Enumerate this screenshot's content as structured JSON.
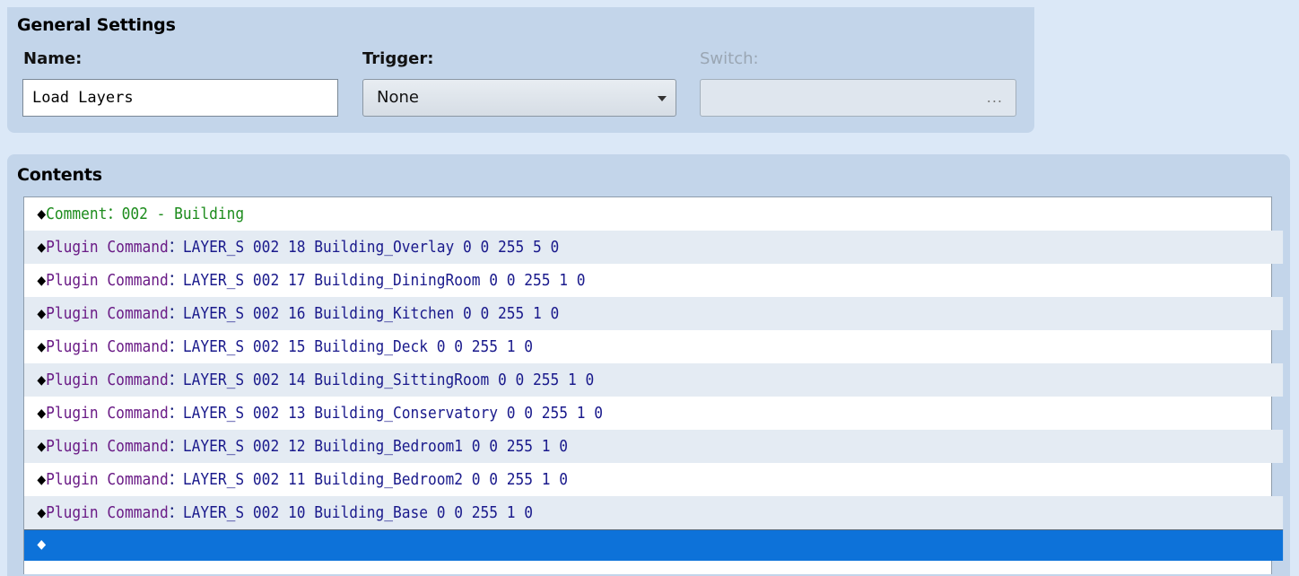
{
  "general": {
    "title": "General Settings",
    "name_label": "Name:",
    "name_value": "Load Layers",
    "trigger_label": "Trigger:",
    "trigger_value": "None",
    "switch_label": "Switch:",
    "switch_button": "..."
  },
  "contents": {
    "title": "Contents",
    "rows": [
      {
        "marker": "◆",
        "command": "Comment",
        "sep": "：",
        "args": "002 - Building"
      },
      {
        "marker": "◆",
        "command": "Plugin Command",
        "sep": "：",
        "args": "LAYER_S 002 18 Building_Overlay 0 0 255 5 0"
      },
      {
        "marker": "◆",
        "command": "Plugin Command",
        "sep": "：",
        "args": "LAYER_S 002 17 Building_DiningRoom 0 0 255 1 0"
      },
      {
        "marker": "◆",
        "command": "Plugin Command",
        "sep": "：",
        "args": "LAYER_S 002 16 Building_Kitchen 0 0 255 1 0"
      },
      {
        "marker": "◆",
        "command": "Plugin Command",
        "sep": "：",
        "args": "LAYER_S 002 15 Building_Deck 0 0 255 1 0"
      },
      {
        "marker": "◆",
        "command": "Plugin Command",
        "sep": "：",
        "args": "LAYER_S 002 14 Building_SittingRoom 0 0 255 1 0"
      },
      {
        "marker": "◆",
        "command": "Plugin Command",
        "sep": "：",
        "args": "LAYER_S 002 13 Building_Conservatory 0 0 255 1 0"
      },
      {
        "marker": "◆",
        "command": "Plugin Command",
        "sep": "：",
        "args": "LAYER_S 002 12 Building_Bedroom1 0 0 255 1 0"
      },
      {
        "marker": "◆",
        "command": "Plugin Command",
        "sep": "：",
        "args": "LAYER_S 002 11 Building_Bedroom2 0 0 255 1 0"
      },
      {
        "marker": "◆",
        "command": "Plugin Command",
        "sep": "：",
        "args": "LAYER_S 002 10 Building_Base 0 0 255 1 0"
      },
      {
        "marker": "◆",
        "command": "",
        "sep": "",
        "args": ""
      }
    ]
  },
  "colors": {
    "background": "#dbe8f7",
    "panel": "#c3d5ea",
    "selected_row": "#0d72d9",
    "comment_text": "#1d8c1d",
    "command_text": "#6a1b86"
  }
}
